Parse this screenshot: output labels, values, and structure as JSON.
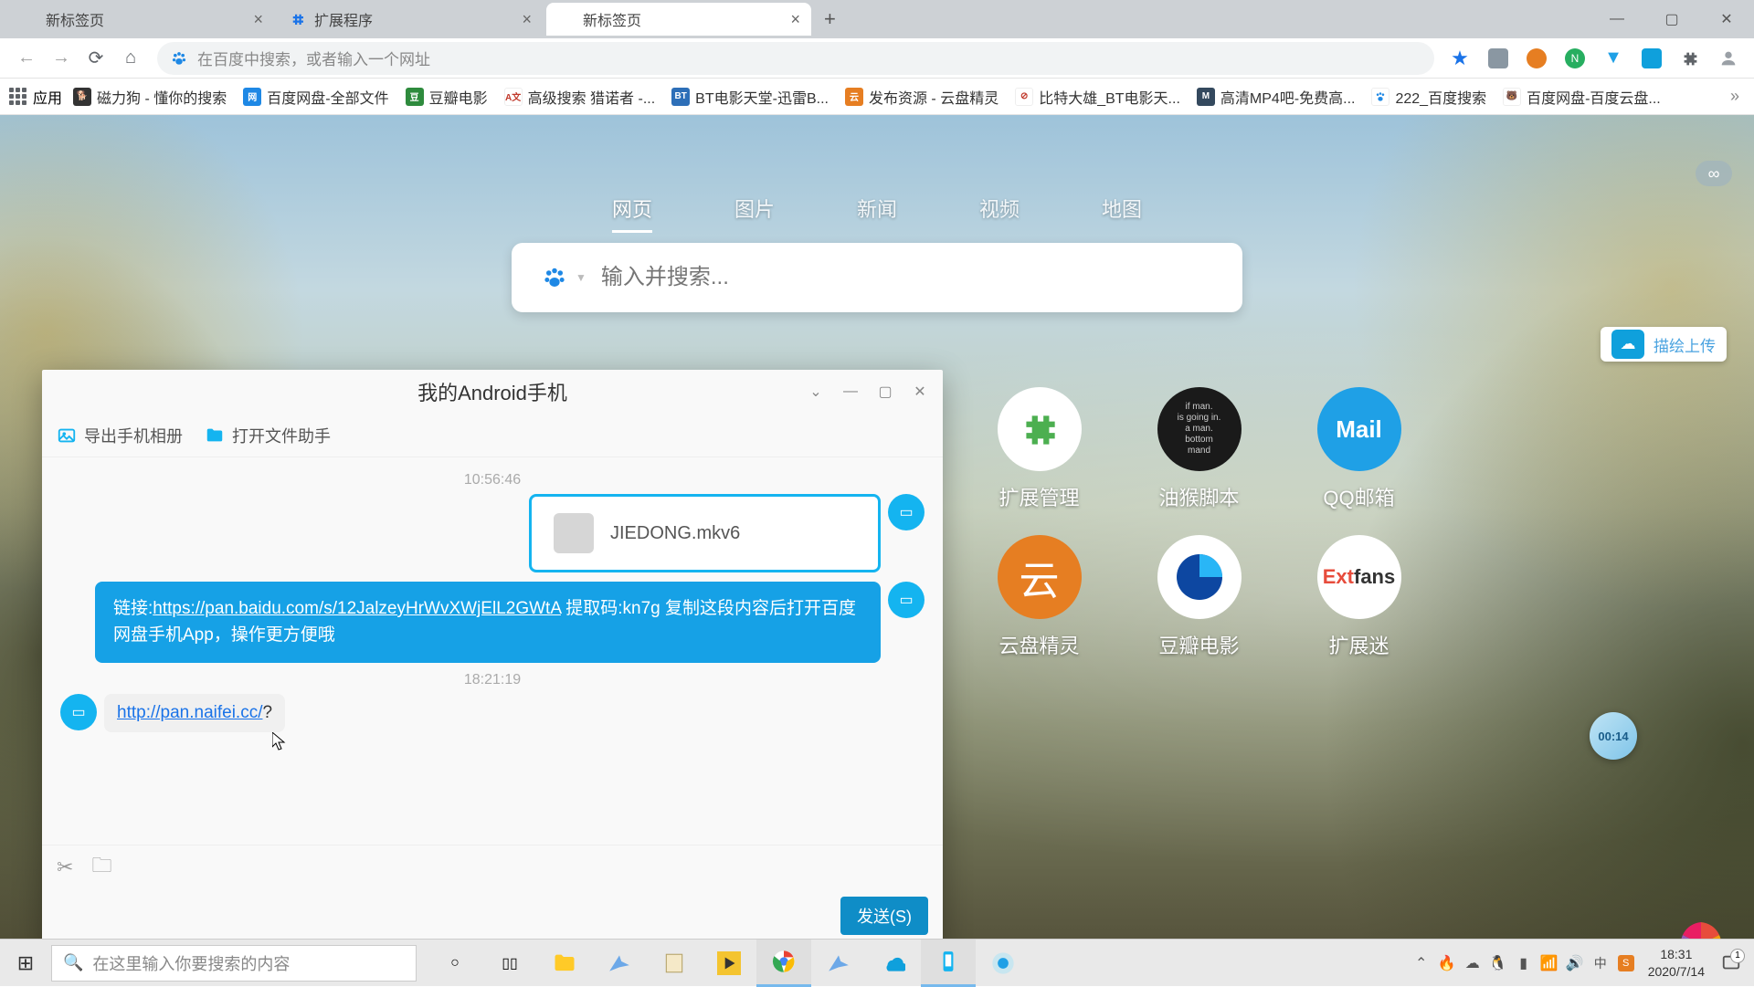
{
  "browser": {
    "tabs": [
      {
        "label": "新标签页",
        "active": false
      },
      {
        "label": "扩展程序",
        "active": false
      },
      {
        "label": "新标签页",
        "active": true
      }
    ],
    "url_placeholder": "在百度中搜索，或者输入一个网址"
  },
  "bookmarks": {
    "apps_label": "应用",
    "items": [
      {
        "label": "磁力狗 - 懂你的搜索",
        "color": "#333"
      },
      {
        "label": "百度网盘-全部文件",
        "color": "#1e88e5",
        "badge": "网"
      },
      {
        "label": "豆瓣电影",
        "color": "#2e8b3d",
        "badge": "豆"
      },
      {
        "label": "高级搜索 猎诺者 -...",
        "color": "#c0392b",
        "badge": "A文"
      },
      {
        "label": "BT电影天堂-迅雷B...",
        "color": "#2d6fb8",
        "badge": "BT"
      },
      {
        "label": "发布资源 - 云盘精灵",
        "color": "#e67e22",
        "badge": "云"
      },
      {
        "label": "比特大雄_BT电影天...",
        "color": "#c0392b",
        "badge": "⊘"
      },
      {
        "label": "高清MP4吧-免费高...",
        "color": "#34495e",
        "badge": "M"
      },
      {
        "label": "222_百度搜索",
        "color": "#1e88e5",
        "badge": "🐾"
      },
      {
        "label": "百度网盘-百度云盘...",
        "color": "#555",
        "badge": "🐻"
      }
    ]
  },
  "page": {
    "search_tabs": [
      {
        "label": "网页",
        "id": "web",
        "active": true
      },
      {
        "label": "图片",
        "id": "images"
      },
      {
        "label": "新闻",
        "id": "news"
      },
      {
        "label": "视频",
        "id": "video"
      },
      {
        "label": "地图",
        "id": "map"
      }
    ],
    "search_placeholder": "输入并搜索...",
    "upload_label": "描绘上传",
    "shortcuts": [
      {
        "label": "扩展管理",
        "bg": "#ffffff",
        "icon": "puzzle"
      },
      {
        "label": "油猴脚本",
        "bg": "#1a1a1a",
        "icon": "monkey"
      },
      {
        "label": "QQ邮箱",
        "bg": "#1fa0e6",
        "icon": "mail",
        "text": "Mail"
      },
      {
        "label": "云盘精灵",
        "bg": "#ffffff",
        "icon": "yunpan"
      },
      {
        "label": "豆瓣电影",
        "bg": "#ffffff",
        "icon": "douban"
      },
      {
        "label": "扩展迷",
        "bg": "#ffffff",
        "icon": "extfans",
        "text": "Extfans"
      }
    ],
    "timer": "00:14"
  },
  "phone_window": {
    "title": "我的Android手机",
    "export_photos": "导出手机相册",
    "open_file_helper": "打开文件助手",
    "time1": "10:56:46",
    "file_name": "JIEDONG.mkv6",
    "text_msg_prefix": "链接:",
    "text_msg_link": "https://pan.baidu.com/s/12JalzeyHrWvXWjElL2GWtA",
    "text_msg_suffix": " 提取码:kn7g 复制这段内容后打开百度网盘手机App，操作更方便哦",
    "time2": "18:21:19",
    "in_link": "http://pan.naifei.cc/",
    "in_suffix": "?",
    "send_label": "发送(S)"
  },
  "taskbar": {
    "search_placeholder": "在这里输入你要搜索的内容",
    "time": "18:31",
    "date": "2020/7/14",
    "notif_count": "1"
  }
}
